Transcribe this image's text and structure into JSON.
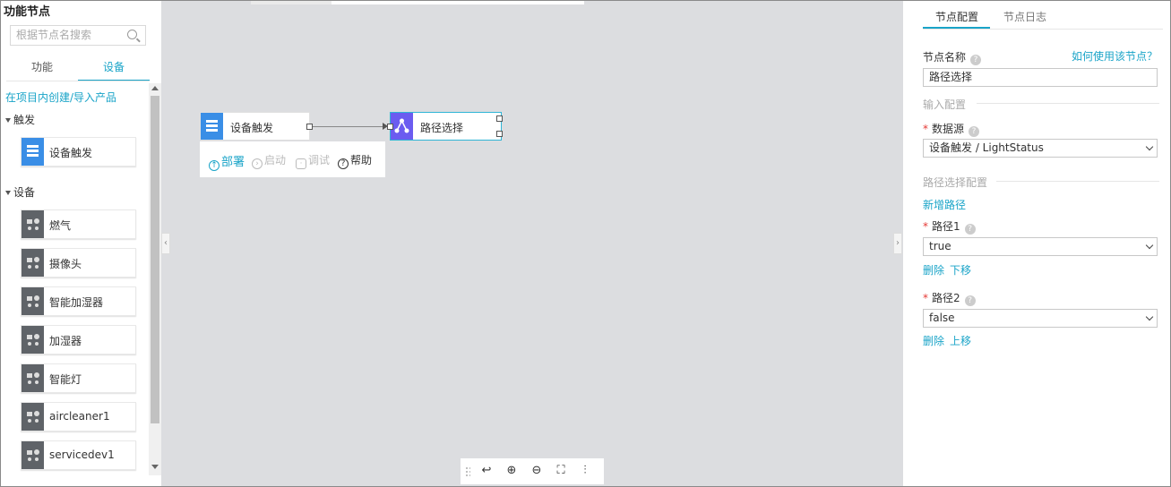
{
  "left_panel": {
    "title": "功能节点",
    "search_placeholder": "根据节点名搜索",
    "tabs": [
      "功能",
      "设备"
    ],
    "create_link": "在项目内创建/导入产品",
    "groups": [
      {
        "label": "触发",
        "items": [
          {
            "label": "设备触发",
            "icon": "trigger-icon"
          }
        ]
      },
      {
        "label": "设备",
        "items": [
          {
            "label": "燃气",
            "icon": "device-icon"
          },
          {
            "label": "摄像头",
            "icon": "device-icon"
          },
          {
            "label": "智能加湿器",
            "icon": "device-icon"
          },
          {
            "label": "加湿器",
            "icon": "device-icon"
          },
          {
            "label": "智能灯",
            "icon": "device-icon"
          },
          {
            "label": "aircleaner1",
            "icon": "device-icon"
          },
          {
            "label": "servicedev1",
            "icon": "device-icon"
          }
        ]
      }
    ]
  },
  "canvas": {
    "nodes": [
      {
        "label": "设备触发",
        "icon": "trigger-icon"
      },
      {
        "label": "路径选择",
        "icon": "route-icon"
      }
    ],
    "node_toolbar": {
      "deploy": "部署",
      "start": "启动",
      "debug": "调试",
      "help": "帮助"
    },
    "bottom_toolbar": [
      "drag-grip-icon",
      "undo-icon",
      "zoom-in-icon",
      "zoom-out-icon",
      "fit-screen-icon",
      "settings-icon"
    ]
  },
  "right_panel": {
    "tabs": [
      "节点配置",
      "节点日志"
    ],
    "node_name_label": "节点名称",
    "how_to_link": "如何使用该节点？",
    "node_name_value": "路径选择",
    "input_section": "输入配置",
    "datasource_label": "数据源",
    "datasource_value": "设备触发 / LightStatus",
    "route_section": "路径选择配置",
    "add_route": "新增路径",
    "routes": [
      {
        "label": "路径1",
        "value": "true",
        "actions": [
          "删除",
          "下移"
        ]
      },
      {
        "label": "路径2",
        "value": "false",
        "actions": [
          "删除",
          "上移"
        ]
      }
    ]
  },
  "colors": {
    "accent": "#1aa4c8",
    "canvas_bg": "#dcdde0",
    "trigger_icon": "#3a8ee6",
    "route_icon": "#6b5cf0",
    "device_icon": "#5f6368"
  }
}
